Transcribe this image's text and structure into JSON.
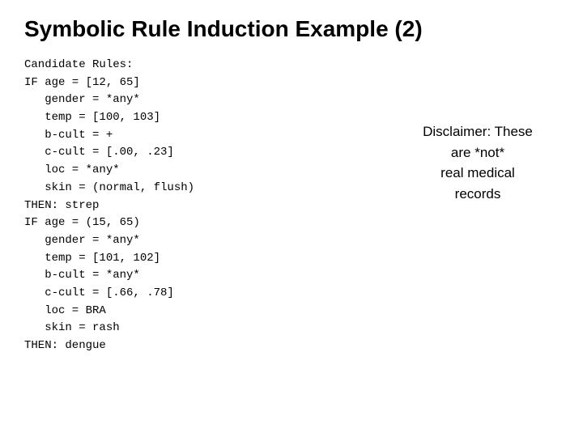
{
  "title": "Symbolic Rule Induction Example (2)",
  "code": {
    "line1": "Candidate Rules:",
    "line2": "IF age = [12, 65]",
    "line3": "   gender = *any*",
    "line4": "   temp = [100, 103]",
    "line5": "   b-cult = +",
    "line6": "   c-cult = [.00, .23]",
    "line7": "   loc = *any*",
    "line8": "   skin = (normal, flush)",
    "line9": "THEN: strep",
    "line10": "IF age = (15, 65)",
    "line11": "   gender = *any*",
    "line12": "   temp = [101, 102]",
    "line13": "   b-cult = *any*",
    "line14": "   c-cult = [.66, .78]",
    "line15": "   loc = BRA",
    "line16": "   skin = rash",
    "line17": "THEN: dengue"
  },
  "disclaimer": {
    "line1": "Disclaimer: These",
    "line2": "are *not*",
    "line3": "real medical",
    "line4": "records"
  }
}
